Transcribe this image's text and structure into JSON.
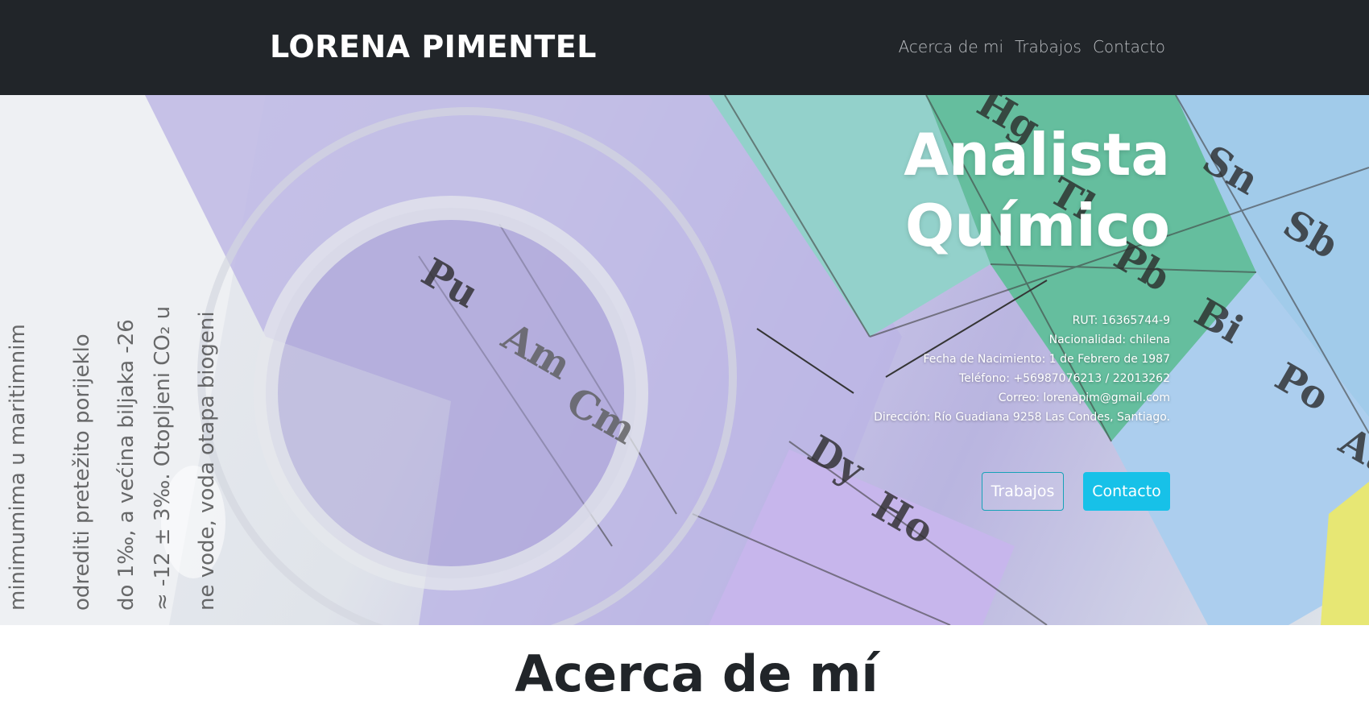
{
  "navbar": {
    "brand": "LORENA PIMENTEL",
    "links": [
      "Acerca de mi",
      "Trabajos",
      "Contacto"
    ]
  },
  "hero": {
    "title_line1": "Analista",
    "title_line2": "Químico",
    "info": {
      "rut": "RUT: 16365744-9",
      "nacionalidad": "Nacionalidad: chilena",
      "nacimiento": "Fecha de Nacimiento: 1 de Febrero de 1987",
      "telefono": "Teléfono: +56987076213 / 22013262",
      "correo": "Correo: lorenapim@gmail.com",
      "direccion": "Dirección: Río Guadiana 9258 Las Condes, Santiago."
    },
    "buttons": {
      "trabajos": "Trabajos",
      "contacto": "Contacto"
    },
    "background_elements": [
      "Pu",
      "Am",
      "Cm",
      "Sn",
      "Sb",
      "Bi",
      "Po",
      "Dy",
      "Ho",
      "Hg",
      "Tl",
      "Pb",
      "At"
    ]
  },
  "section": {
    "title": "Acerca de mí"
  },
  "colors": {
    "navbar_bg": "#212529",
    "accent": "#17c1e8",
    "outline": "#17a2b8"
  }
}
